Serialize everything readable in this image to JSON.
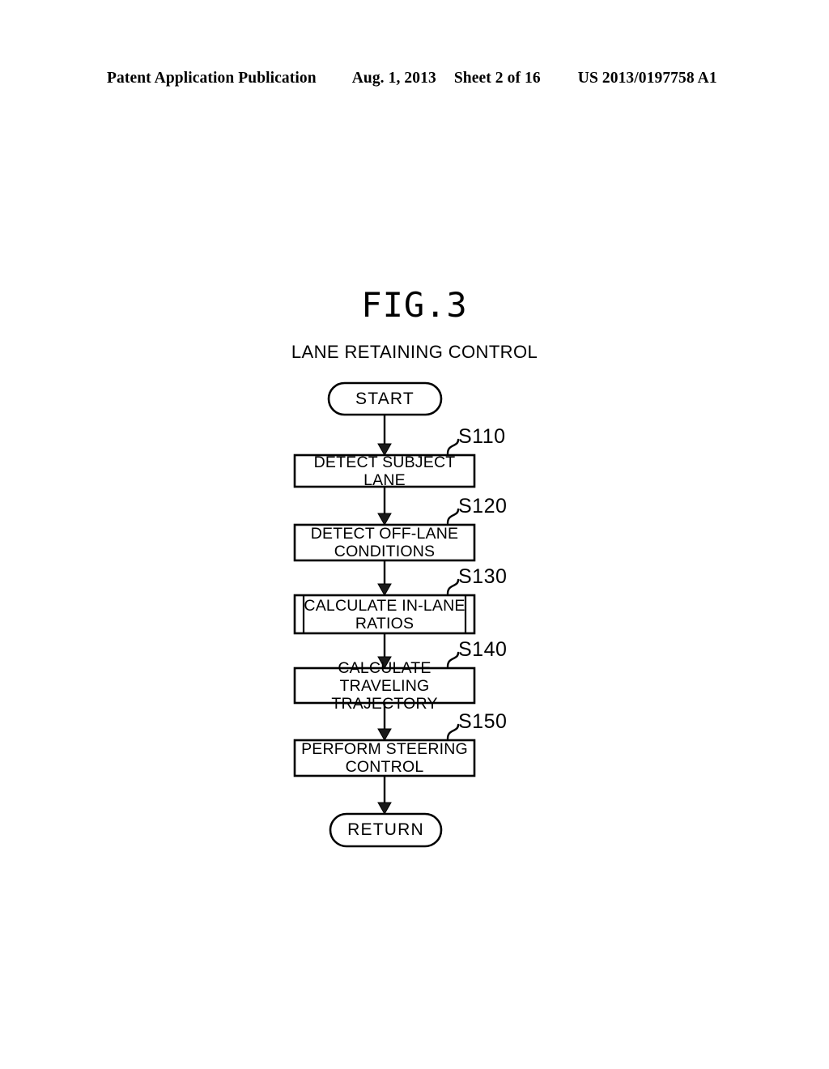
{
  "header": {
    "publication": "Patent Application Publication",
    "date": "Aug. 1, 2013",
    "sheet": "Sheet 2 of 16",
    "patent_number": "US 2013/0197758 A1"
  },
  "figure": {
    "number": "FIG.3",
    "caption": "LANE RETAINING CONTROL"
  },
  "flowchart": {
    "start": {
      "label": "START"
    },
    "end": {
      "label": "RETURN"
    },
    "steps": [
      {
        "id": "S110",
        "text": "DETECT SUBJECT LANE",
        "shape": "process"
      },
      {
        "id": "S120",
        "text": "DETECT OFF-LANE\nCONDITIONS",
        "shape": "process"
      },
      {
        "id": "S130",
        "text": "CALCULATE IN-LANE\nRATIOS",
        "shape": "predefined-process"
      },
      {
        "id": "S140",
        "text": "CALCULATE TRAVELING\nTRAJECTORY",
        "shape": "process"
      },
      {
        "id": "S150",
        "text": "PERFORM STEERING\nCONTROL",
        "shape": "process"
      }
    ]
  },
  "colors": {
    "ink": "#000000",
    "paper": "#ffffff"
  }
}
